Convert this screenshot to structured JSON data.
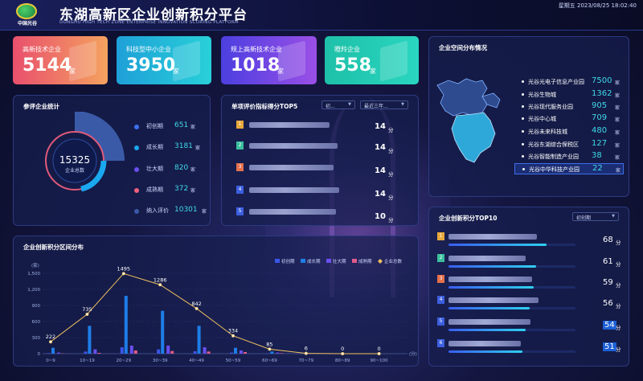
{
  "header": {
    "title": "东湖高新区企业创新积分平台",
    "subtitle": "DONGHU HIGH TECH ZONE ENTERPRISE INNOVATION SCORING PLATFORM",
    "logo_text": "中国光谷",
    "datetime": "星期五 2023/08/25 18:02:40"
  },
  "cards": [
    {
      "label": "高新技术企业",
      "value": "5144",
      "unit": "家"
    },
    {
      "label": "科技型中小企业",
      "value": "3950",
      "unit": "家"
    },
    {
      "label": "规上高新技术企业",
      "value": "1018",
      "unit": "家"
    },
    {
      "label": "瞪羚企业",
      "value": "558",
      "unit": "家"
    }
  ],
  "participants": {
    "title": "参评企业统计",
    "total": "15325",
    "total_label": "企业总数",
    "items": [
      {
        "name": "初创期",
        "value": "651",
        "unit": "家",
        "color": "#3d6ff0"
      },
      {
        "name": "成长期",
        "value": "3181",
        "unit": "家",
        "color": "#1aa8f0"
      },
      {
        "name": "壮大期",
        "value": "820",
        "unit": "家",
        "color": "#6a4ff0"
      },
      {
        "name": "成熟期",
        "value": "372",
        "unit": "家",
        "color": "#f0607a"
      },
      {
        "name": "纳入评价",
        "value": "10301",
        "unit": "家",
        "color": "#3a5aa8"
      }
    ]
  },
  "top5": {
    "title": "单项评价指标得分TOP5",
    "filter1": "初...",
    "filter2": "最近三年...",
    "rows": [
      {
        "rank": "1",
        "score": "14",
        "unit": "分"
      },
      {
        "rank": "2",
        "score": "14",
        "unit": "分"
      },
      {
        "rank": "3",
        "score": "14",
        "unit": "分"
      },
      {
        "rank": "4",
        "score": "14",
        "unit": "分"
      },
      {
        "rank": "5",
        "score": "10",
        "unit": "分"
      }
    ]
  },
  "map_panel": {
    "title": "企业空间分布情况",
    "items": [
      {
        "name": "光谷光电子信息产业园",
        "value": "7500",
        "unit": "家"
      },
      {
        "name": "光谷生物城",
        "value": "1362",
        "unit": "家"
      },
      {
        "name": "光谷现代服务业园",
        "value": "905",
        "unit": "家"
      },
      {
        "name": "光谷中心城",
        "value": "709",
        "unit": "家"
      },
      {
        "name": "光谷未来科技城",
        "value": "480",
        "unit": "家"
      },
      {
        "name": "光谷东湖综合保税区",
        "value": "127",
        "unit": "家"
      },
      {
        "name": "光谷智能制造产业园",
        "value": "38",
        "unit": "家"
      },
      {
        "name": "光谷中华科技产业园",
        "value": "22",
        "unit": "家"
      }
    ],
    "selected_index": 7
  },
  "distribution": {
    "title": "企业创新积分区间分布",
    "legend": [
      "初创期",
      "成长期",
      "壮大期",
      "成熟期",
      "企业总数"
    ],
    "y_unit": "(家)",
    "x_unit": "(分)"
  },
  "top10": {
    "title": "企业创新积分TOP10",
    "filter": "初创期",
    "rows": [
      {
        "rank": "1",
        "score": "68",
        "unit": "分",
        "progress": 0.77
      },
      {
        "rank": "2",
        "score": "61",
        "unit": "分",
        "progress": 0.69
      },
      {
        "rank": "3",
        "score": "59",
        "unit": "分",
        "progress": 0.67
      },
      {
        "rank": "4",
        "score": "56",
        "unit": "分",
        "progress": 0.64
      },
      {
        "rank": "5",
        "score": "54",
        "unit": "分",
        "progress": 0.61
      },
      {
        "rank": "6",
        "score": "51",
        "unit": "分",
        "progress": 0.58
      }
    ]
  },
  "chart_data": {
    "type": "bar",
    "categories": [
      "0~9",
      "10~19",
      "20~29",
      "30~39",
      "40~49",
      "50~59",
      "60~69",
      "70~79",
      "80~89",
      "90~100"
    ],
    "series": [
      {
        "name": "初创期",
        "values": [
          10,
          40,
          120,
          80,
          45,
          20,
          8,
          0,
          0,
          0
        ],
        "color": "#3a56e8"
      },
      {
        "name": "成长期",
        "values": [
          110,
          520,
          1080,
          800,
          520,
          110,
          40,
          4,
          0,
          0
        ],
        "color": "#1e7ee8"
      },
      {
        "name": "壮大期",
        "values": [
          20,
          80,
          150,
          150,
          120,
          60,
          20,
          2,
          0,
          0
        ],
        "color": "#6a4ff0"
      },
      {
        "name": "成熟期",
        "values": [
          5,
          15,
          60,
          50,
          40,
          30,
          10,
          0,
          0,
          0
        ],
        "color": "#e05a8a"
      },
      {
        "name": "企业总数",
        "values": [
          222,
          735,
          1495,
          1286,
          842,
          334,
          85,
          6,
          0,
          0
        ],
        "color": "#f0c060",
        "line": true
      }
    ],
    "ylim": [
      0,
      1500
    ],
    "yticks": [
      "0",
      "300",
      "600",
      "900",
      "1,200",
      "1,500"
    ]
  }
}
